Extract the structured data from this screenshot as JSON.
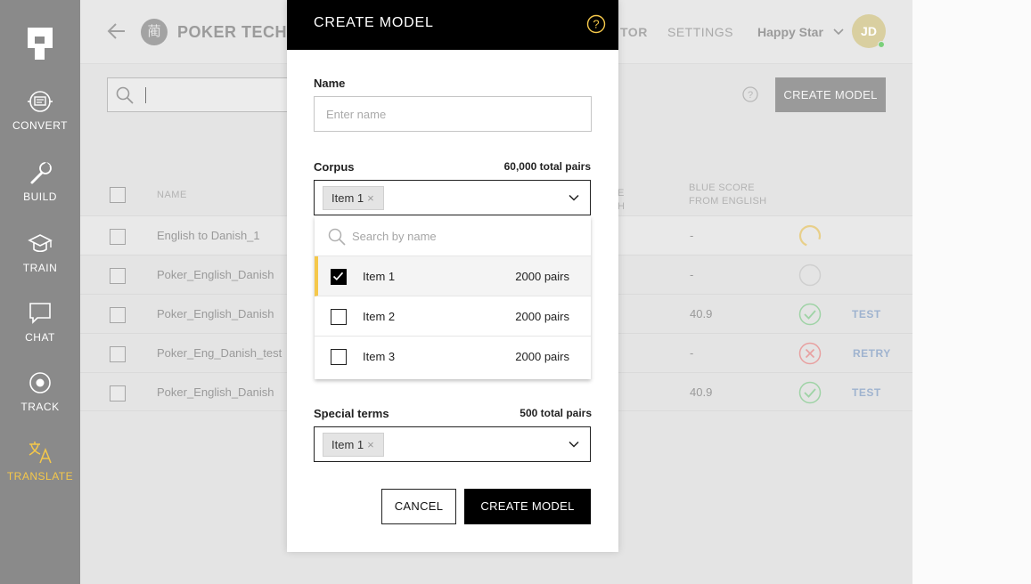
{
  "sidebar": {
    "items": [
      {
        "label": "CONVERT",
        "icon": "convert-icon"
      },
      {
        "label": "BUILD",
        "icon": "wrench-icon"
      },
      {
        "label": "TRAIN",
        "icon": "graduation-cap-icon"
      },
      {
        "label": "CHAT",
        "icon": "chat-bubble-icon"
      },
      {
        "label": "TRACK",
        "icon": "target-icon"
      },
      {
        "label": "TRANSLATE",
        "icon": "translate-icon"
      }
    ],
    "active": "TRANSLATE",
    "accent_color": "#f5c84a"
  },
  "header": {
    "project_icon_char": "蔺",
    "project_name": "POKER TECH",
    "tab_partial": "TOR",
    "tab_settings": "SETTINGS",
    "user_name": "Happy Star",
    "avatar_initials": "JD"
  },
  "toolbar": {
    "create_model_label": "CREATE MODEL"
  },
  "table": {
    "headers": {
      "name": "NAME",
      "score_to": "E\nH",
      "blue_score_line1": "BLUE SCORE",
      "blue_score_line2": "FROM ENGLISH"
    },
    "rows": [
      {
        "name": "English to Danish_1",
        "score": "-",
        "status": "loading",
        "action": ""
      },
      {
        "name": "Poker_English_Danish",
        "score": "-",
        "status": "pending",
        "action": ""
      },
      {
        "name": "Poker_English_Danish",
        "score": "40.9",
        "status": "success",
        "action": "TEST"
      },
      {
        "name": "Poker_Eng_Danish_test",
        "score": "-",
        "status": "failed",
        "action": "RETRY"
      },
      {
        "name": "Poker_English_Danish",
        "score": "40.9",
        "status": "success",
        "action": "TEST"
      }
    ]
  },
  "modal": {
    "title": "CREATE MODEL",
    "name_label": "Name",
    "name_placeholder": "Enter name",
    "corpus_label": "Corpus",
    "corpus_total": "60,000 total pairs",
    "corpus_selected_chip": "Item 1",
    "dropdown": {
      "search_placeholder": "Search by name",
      "items": [
        {
          "label": "Item 1",
          "pairs": "2000 pairs",
          "checked": true
        },
        {
          "label": "Item 2",
          "pairs": "2000 pairs",
          "checked": false
        },
        {
          "label": "Item 3",
          "pairs": "2000 pairs",
          "checked": false
        }
      ]
    },
    "special_terms_label": "Special terms",
    "special_terms_total": "500 total pairs",
    "special_terms_chip": "Item 1",
    "cancel_label": "CANCEL",
    "create_label": "CREATE MODEL"
  }
}
